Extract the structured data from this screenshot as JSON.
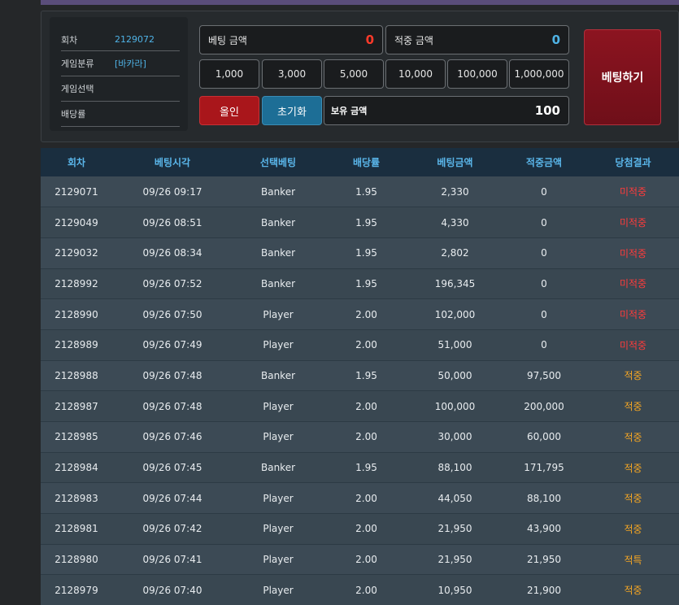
{
  "info": {
    "round_label": "회차",
    "round_value": "2129072",
    "category_label": "게임분류",
    "category_value": "[바카라]",
    "select_label": "게임선택",
    "select_value": "",
    "odds_label": "배당률",
    "odds_value": ""
  },
  "bet": {
    "bet_amount_label": "베팅 금액",
    "bet_amount_value": "0",
    "win_amount_label": "적중 금액",
    "win_amount_value": "0",
    "chips": [
      "1,000",
      "3,000",
      "5,000",
      "10,000",
      "100,000",
      "1,000,000"
    ],
    "allin_label": "올인",
    "reset_label": "초기화",
    "balance_label": "보유 금액",
    "balance_value": "100",
    "submit_label": "베팅하기"
  },
  "table": {
    "headers": [
      "회차",
      "베팅시각",
      "선택베팅",
      "배당률",
      "베팅금액",
      "적중금액",
      "당첨결과"
    ],
    "rows": [
      [
        "2129071",
        "09/26 09:17",
        "Banker",
        "1.95",
        "2,330",
        "0",
        "미적중"
      ],
      [
        "2129049",
        "09/26 08:51",
        "Banker",
        "1.95",
        "4,330",
        "0",
        "미적중"
      ],
      [
        "2129032",
        "09/26 08:34",
        "Banker",
        "1.95",
        "2,802",
        "0",
        "미적중"
      ],
      [
        "2128992",
        "09/26 07:52",
        "Banker",
        "1.95",
        "196,345",
        "0",
        "미적중"
      ],
      [
        "2128990",
        "09/26 07:50",
        "Player",
        "2.00",
        "102,000",
        "0",
        "미적중"
      ],
      [
        "2128989",
        "09/26 07:49",
        "Player",
        "2.00",
        "51,000",
        "0",
        "미적중"
      ],
      [
        "2128988",
        "09/26 07:48",
        "Banker",
        "1.95",
        "50,000",
        "97,500",
        "적중"
      ],
      [
        "2128987",
        "09/26 07:48",
        "Player",
        "2.00",
        "100,000",
        "200,000",
        "적중"
      ],
      [
        "2128985",
        "09/26 07:46",
        "Player",
        "2.00",
        "30,000",
        "60,000",
        "적중"
      ],
      [
        "2128984",
        "09/26 07:45",
        "Banker",
        "1.95",
        "88,100",
        "171,795",
        "적중"
      ],
      [
        "2128983",
        "09/26 07:44",
        "Player",
        "2.00",
        "44,050",
        "88,100",
        "적중"
      ],
      [
        "2128981",
        "09/26 07:42",
        "Player",
        "2.00",
        "21,950",
        "43,900",
        "적중"
      ],
      [
        "2128980",
        "09/26 07:41",
        "Player",
        "2.00",
        "21,950",
        "21,950",
        "적특"
      ],
      [
        "2128979",
        "09/26 07:40",
        "Player",
        "2.00",
        "10,950",
        "21,900",
        "적중"
      ]
    ]
  },
  "colors": {
    "accent_blue": "#4fb3e6",
    "miss_red": "#ff3b3b",
    "hit_orange": "#f5a623",
    "submit_red": "#8c1420"
  }
}
